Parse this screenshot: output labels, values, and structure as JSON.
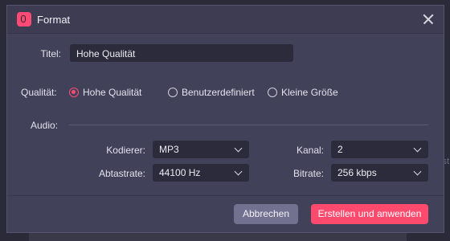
{
  "dialog": {
    "title": "Format",
    "icon": "app-logo-icon"
  },
  "form": {
    "title_label": "Titel:",
    "title_value": "Hohe Qualität",
    "quality_label": "Qualität:",
    "quality_options": [
      {
        "label": "Hohe Qualität",
        "selected": true
      },
      {
        "label": "Benutzerdefiniert",
        "selected": false
      },
      {
        "label": "Kleine Größe",
        "selected": false
      }
    ]
  },
  "audio": {
    "section_label": "Audio:",
    "encoder_label": "Kodierer:",
    "encoder_value": "MP3",
    "samplerate_label": "Abtastrate:",
    "samplerate_value": "44100 Hz",
    "channel_label": "Kanal:",
    "channel_value": "2",
    "bitrate_label": "Bitrate:",
    "bitrate_value": "256 kbps"
  },
  "buttons": {
    "cancel": "Abbrechen",
    "apply": "Erstellen und anwenden"
  },
  "background": {
    "ghost_text": "st"
  },
  "colors": {
    "accent": "#ff4a6e",
    "dialog_bg": "#42415a",
    "input_bg": "#2c2b3b"
  }
}
